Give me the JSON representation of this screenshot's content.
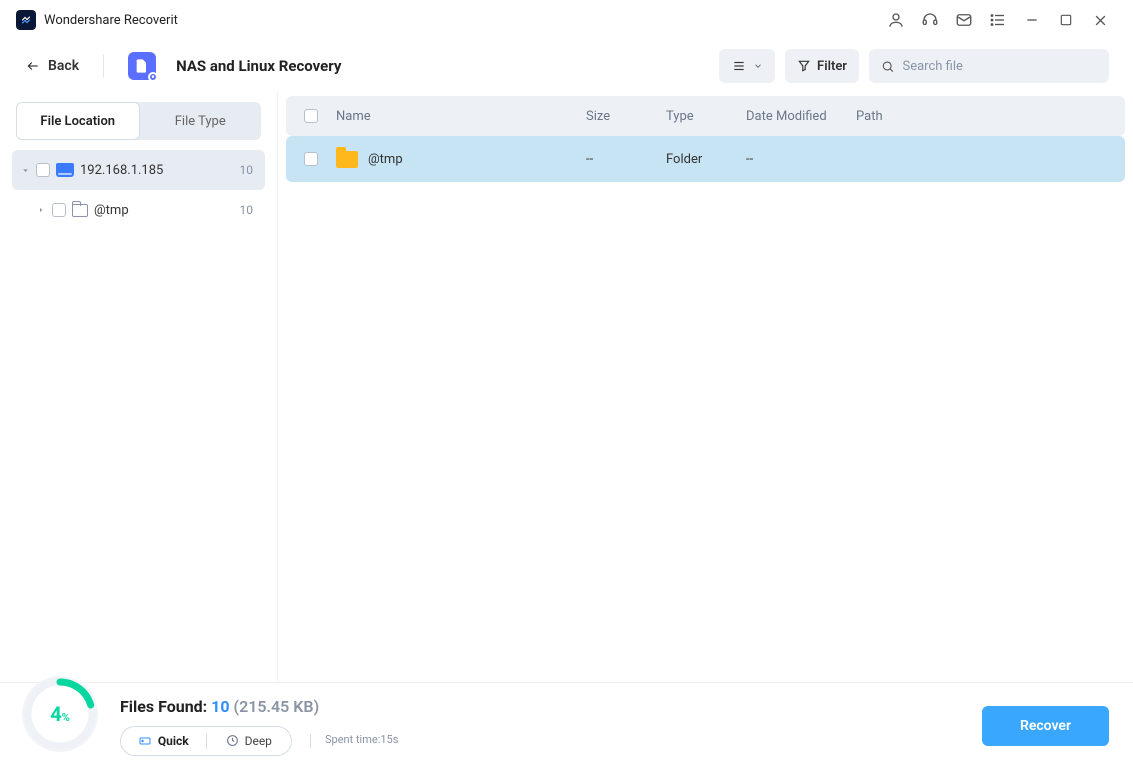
{
  "app": {
    "title": "Wondershare Recoverit"
  },
  "nav": {
    "back": "Back",
    "mode": "NAS and Linux Recovery"
  },
  "actions": {
    "filter": "Filter",
    "search_placeholder": "Search file"
  },
  "sidebar": {
    "tabs": {
      "location": "File Location",
      "type": "File Type"
    },
    "rootLabel": "192.168.1.185",
    "rootCount": "10",
    "childLabel": "@tmp",
    "childCount": "10"
  },
  "table": {
    "headers": {
      "name": "Name",
      "size": "Size",
      "type": "Type",
      "date": "Date Modified",
      "path": "Path"
    },
    "rows": [
      {
        "name": "@tmp",
        "size": "--",
        "type": "Folder",
        "date": "--",
        "path": ""
      }
    ]
  },
  "footer": {
    "percent": "4",
    "filesFoundLabel": "Files Found: ",
    "filesFoundCount": "10",
    "filesFoundSize": "(215.45 KB)",
    "quick": "Quick",
    "deep": "Deep",
    "spent": "Spent time:15s",
    "recover": "Recover"
  }
}
